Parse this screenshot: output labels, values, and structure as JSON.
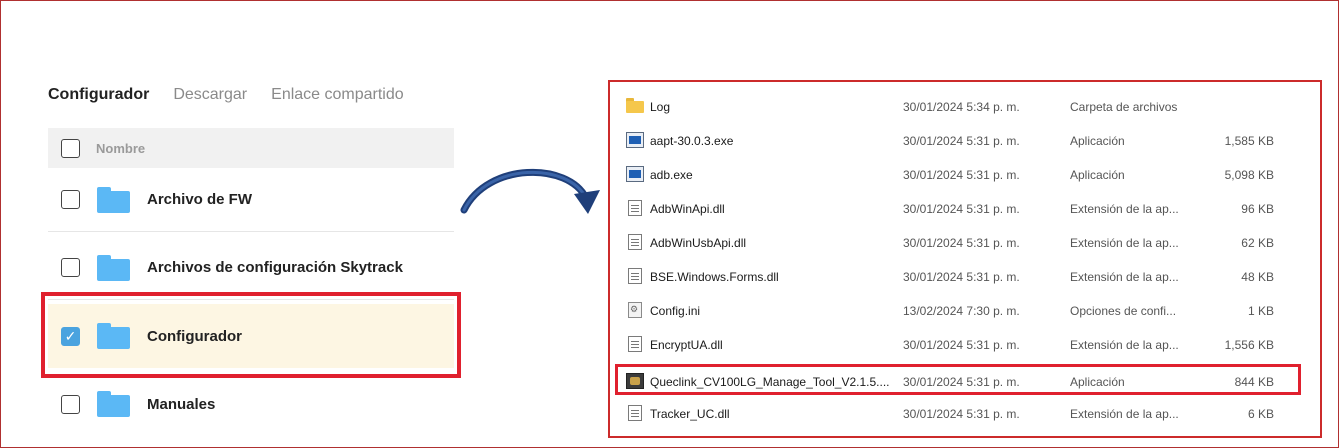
{
  "left": {
    "tabs": [
      {
        "label": "Configurador",
        "active": true
      },
      {
        "label": "Descargar",
        "active": false
      },
      {
        "label": "Enlace compartido",
        "active": false
      }
    ],
    "column_header": "Nombre",
    "rows": [
      {
        "name": "Archivo de FW",
        "checked": false
      },
      {
        "name": "Archivos de configuración Skytrack",
        "checked": false
      },
      {
        "name": "Configurador",
        "checked": true
      },
      {
        "name": "Manuales",
        "checked": false
      }
    ]
  },
  "explorer": {
    "files": [
      {
        "name": "Log",
        "date": "30/01/2024 5:34 p. m.",
        "type": "Carpeta de archivos",
        "size": "",
        "icon": "folder-icon"
      },
      {
        "name": "aapt-30.0.3.exe",
        "date": "30/01/2024 5:31 p. m.",
        "type": "Aplicación",
        "size": "1,585 KB",
        "icon": "exe-icon"
      },
      {
        "name": "adb.exe",
        "date": "30/01/2024 5:31 p. m.",
        "type": "Aplicación",
        "size": "5,098 KB",
        "icon": "exe-icon"
      },
      {
        "name": "AdbWinApi.dll",
        "date": "30/01/2024 5:31 p. m.",
        "type": "Extensión de la ap...",
        "size": "96 KB",
        "icon": "dll-icon"
      },
      {
        "name": "AdbWinUsbApi.dll",
        "date": "30/01/2024 5:31 p. m.",
        "type": "Extensión de la ap...",
        "size": "62 KB",
        "icon": "dll-icon"
      },
      {
        "name": "BSE.Windows.Forms.dll",
        "date": "30/01/2024 5:31 p. m.",
        "type": "Extensión de la ap...",
        "size": "48 KB",
        "icon": "dll-icon"
      },
      {
        "name": "Config.ini",
        "date": "13/02/2024 7:30 p. m.",
        "type": "Opciones de confi...",
        "size": "1 KB",
        "icon": "ini-icon"
      },
      {
        "name": "EncryptUA.dll",
        "date": "30/01/2024 5:31 p. m.",
        "type": "Extensión de la ap...",
        "size": "1,556 KB",
        "icon": "dll-icon"
      },
      {
        "name": "Queclink_CV100LG_Manage_Tool_V2.1.5....",
        "date": "30/01/2024 5:31 p. m.",
        "type": "Aplicación",
        "size": "844 KB",
        "icon": "app-icon"
      },
      {
        "name": "Tracker_UC.dll",
        "date": "30/01/2024 5:31 p. m.",
        "type": "Extensión de la ap...",
        "size": "6 KB",
        "icon": "dll-icon"
      }
    ]
  },
  "colors": {
    "highlight": "#e0202e",
    "folder_blue": "#5bb8f5",
    "checkbox_checked": "#4aa3df",
    "selected_row_bg": "#fdf6e3",
    "arrow": "#1f3f7a"
  }
}
